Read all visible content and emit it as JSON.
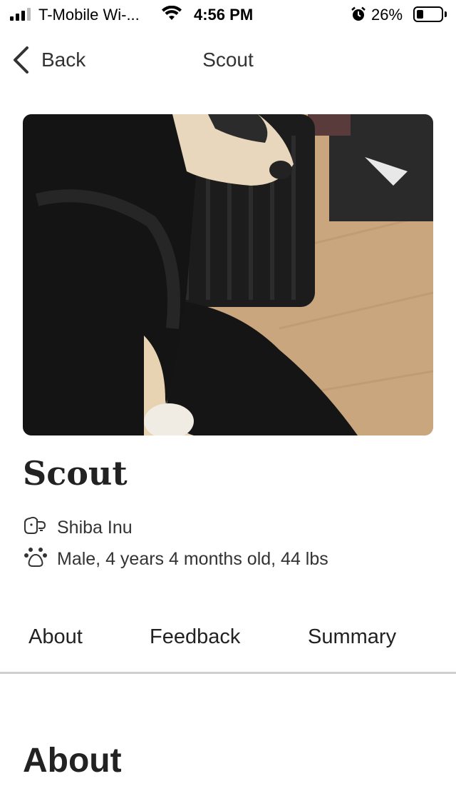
{
  "status_bar": {
    "carrier": "T-Mobile Wi-...",
    "time": "4:56 PM",
    "battery_percent": "26%",
    "battery_level": 0.26,
    "icons": [
      "signal-icon",
      "wifi-icon",
      "alarm-icon",
      "battery-icon"
    ]
  },
  "nav": {
    "back_label": "Back",
    "title": "Scout"
  },
  "pet": {
    "name": "Scout",
    "breed": "Shiba Inu",
    "details": "Male, 4 years 4 months old, 44 lbs"
  },
  "tabs": [
    {
      "label": "About"
    },
    {
      "label": "Feedback"
    },
    {
      "label": "Summary"
    }
  ],
  "section": {
    "heading": "About"
  },
  "colors": {
    "text": "#222222",
    "divider": "#cfcfcf",
    "background": "#ffffff"
  }
}
